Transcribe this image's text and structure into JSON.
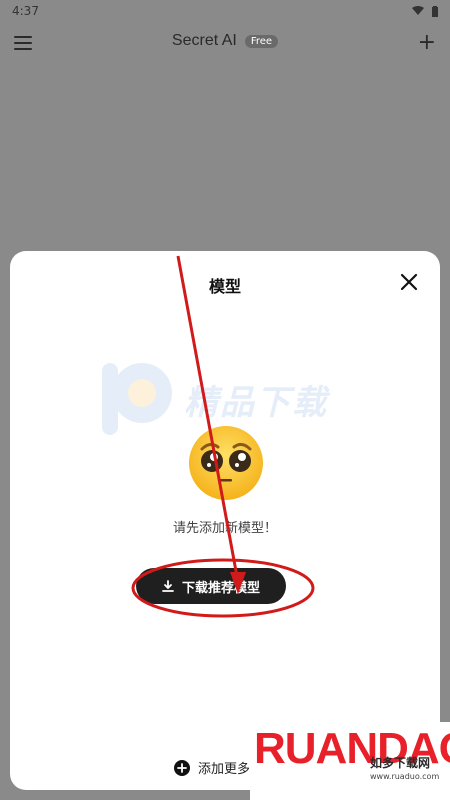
{
  "status_bar": {
    "time": "4:37"
  },
  "app_bar": {
    "title": "Secret AI",
    "badge": "Free"
  },
  "sheet": {
    "title": "模型",
    "watermark_text": "精品下载",
    "empty_message": "请先添加新模型！",
    "download_button": "下载推荐模型",
    "add_more": "添加更多"
  },
  "logo": {
    "brand": "RUANDAO",
    "sub": "如多下载网",
    "url": "www.ruaduo.com"
  },
  "colors": {
    "annotation_red": "#d11a1a",
    "button_bg": "#1f1f1f",
    "overlay": "#8a8a8a"
  }
}
